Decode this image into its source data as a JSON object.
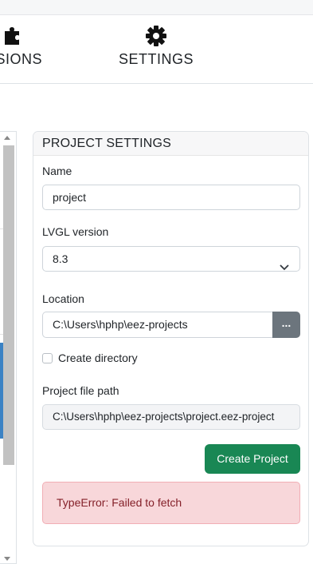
{
  "nav": {
    "extensions_label": "NSIONS",
    "settings_label": "SETTINGS"
  },
  "project_settings": {
    "title": "PROJECT SETTINGS",
    "name_label": "Name",
    "name_value": "project",
    "lvgl_label": "LVGL version",
    "lvgl_value": "8.3",
    "location_label": "Location",
    "location_value": "C:\\Users\\hphp\\eez-projects",
    "browse_label": "...",
    "create_directory_label": "Create directory",
    "create_directory_checked": false,
    "file_path_label": "Project file path",
    "file_path_value": "C:\\Users\\hphp\\eez-projects\\project.eez-project",
    "create_button_label": "Create Project",
    "error_message": "TypeError: Failed to fetch"
  },
  "colors": {
    "primary_success": "#198754",
    "secondary": "#6c757d",
    "alert_bg": "#f8d7da",
    "alert_text": "#842029"
  },
  "icons": [
    "puzzle-icon",
    "gear-icon",
    "chevron-down-icon",
    "scroll-up-arrow-icon",
    "scroll-down-arrow-icon"
  ]
}
